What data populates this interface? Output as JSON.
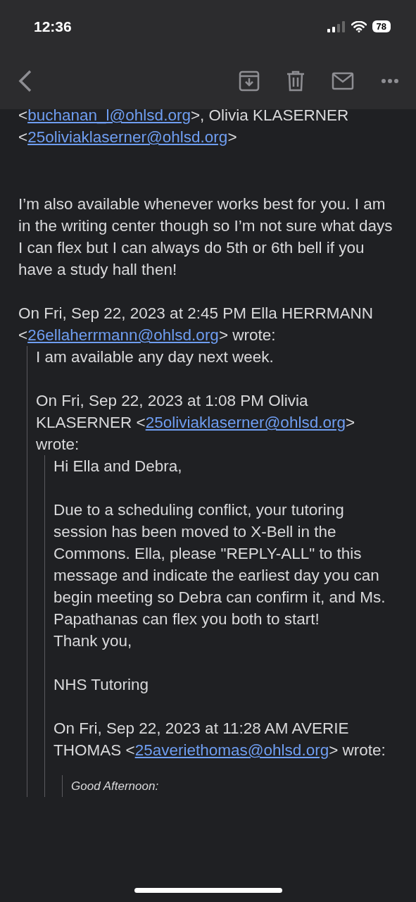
{
  "status_bar": {
    "time": "12:36",
    "battery": "78"
  },
  "recipients": [
    {
      "kind": "text",
      "text": "<"
    },
    {
      "kind": "link",
      "text": "buchanan_l@ohlsd.org"
    },
    {
      "kind": "text",
      "text": ">, Olivia KLASERNER "
    },
    {
      "kind": "text",
      "text": "<"
    },
    {
      "kind": "link",
      "text": "25oliviaklaserner@ohlsd.org"
    },
    {
      "kind": "text",
      "text": ">"
    }
  ],
  "message": {
    "paragraphs": [
      "I’m also available whenever works best for you. I am in the writing center though so I’m not sure what days I can flex but I can always do 5th or 6th bell if you have a study hall then!"
    ],
    "quote": {
      "attribution": [
        {
          "kind": "text",
          "text": "On Fri, Sep 22, 2023 at 2:45 PM Ella HERRMANN <"
        },
        {
          "kind": "link",
          "text": "26ellaherrmann@ohlsd.org"
        },
        {
          "kind": "text",
          "text": "> wrote:"
        }
      ],
      "paragraphs": [
        "I am available any day next week."
      ],
      "italic": false,
      "quote": {
        "attribution": [
          {
            "kind": "text",
            "text": "On Fri, Sep 22, 2023 at 1:08 PM Olivia KLASERNER <"
          },
          {
            "kind": "link",
            "text": "25oliviaklaserner@ohlsd.org"
          },
          {
            "kind": "text",
            "text": "> wrote:"
          }
        ],
        "paragraphs": [
          "Hi Ella and Debra,",
          "Due to a scheduling conflict, your tutoring session has been moved to X-Bell in the Commons. Ella, please \"REPLY-ALL\" to this message and indicate the earliest day you can begin meeting so Debra can confirm it, and Ms. Papathanas can flex you both to start!\nThank you,",
          "NHS Tutoring"
        ],
        "italic": false,
        "quote": {
          "attribution": [
            {
              "kind": "text",
              "text": "On Fri, Sep 22, 2023 at 11:28 AM AVERIE THOMAS <"
            },
            {
              "kind": "link",
              "text": "25averiethomas@ohlsd.org"
            },
            {
              "kind": "text",
              "text": "> wrote:"
            }
          ],
          "paragraphs": [
            "Good Afternoon:"
          ],
          "italic": true
        }
      }
    }
  }
}
